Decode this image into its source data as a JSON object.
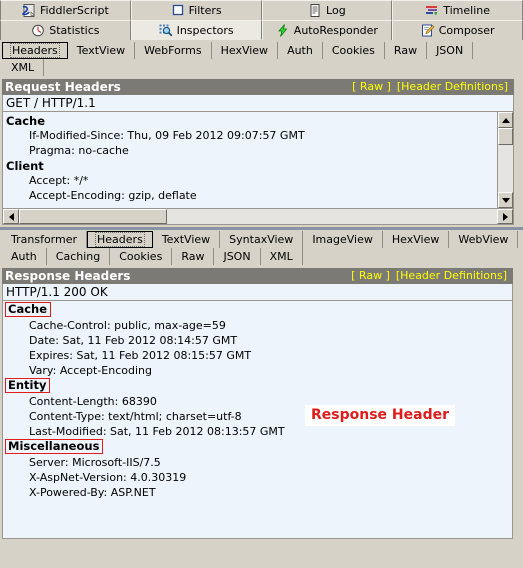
{
  "main_tabs": {
    "row1": [
      {
        "label": "FiddlerScript",
        "icon": "script-icon",
        "selected": false
      },
      {
        "label": "Filters",
        "icon": "filters-icon",
        "selected": false
      },
      {
        "label": "Log",
        "icon": "log-icon",
        "selected": false
      },
      {
        "label": "Timeline",
        "icon": "timeline-icon",
        "selected": false
      }
    ],
    "row2": [
      {
        "label": "Statistics",
        "icon": "statistics-icon",
        "selected": false
      },
      {
        "label": "Inspectors",
        "icon": "inspectors-icon",
        "selected": true
      },
      {
        "label": "AutoResponder",
        "icon": "autoresponder-icon",
        "selected": false
      },
      {
        "label": "Composer",
        "icon": "composer-icon",
        "selected": false
      }
    ]
  },
  "request_tabs": {
    "row1": [
      "Headers",
      "TextView",
      "WebForms",
      "HexView",
      "Auth",
      "Cookies",
      "Raw",
      "JSON"
    ],
    "row2": [
      "XML"
    ],
    "selected": "Headers"
  },
  "request_panel": {
    "title": "Request Headers",
    "raw_link": "[ Raw ]",
    "definitions_link": "[Header Definitions]",
    "status_line": "GET / HTTP/1.1",
    "groups": [
      {
        "name": "Cache",
        "marked": false,
        "headers": [
          "If-Modified-Since: Thu, 09 Feb 2012 09:07:57 GMT",
          "Pragma: no-cache"
        ]
      },
      {
        "name": "Client",
        "marked": false,
        "headers": [
          "Accept: */*",
          "Accept-Encoding: gzip, deflate"
        ]
      }
    ]
  },
  "response_tabs": {
    "row1": [
      "Transformer",
      "Headers",
      "TextView",
      "SyntaxView",
      "ImageView",
      "HexView",
      "WebView"
    ],
    "row2": [
      "Auth",
      "Caching",
      "Cookies",
      "Raw",
      "JSON",
      "XML"
    ],
    "selected": "Headers"
  },
  "response_panel": {
    "title": "Response Headers",
    "raw_link": "[ Raw ]",
    "definitions_link": "[Header Definitions]",
    "status_line": "HTTP/1.1 200 OK",
    "groups": [
      {
        "name": "Cache",
        "marked": true,
        "headers": [
          "Cache-Control: public, max-age=59",
          "Date: Sat, 11 Feb 2012 08:14:57 GMT",
          "Expires: Sat, 11 Feb 2012 08:15:57 GMT",
          "Vary: Accept-Encoding"
        ]
      },
      {
        "name": "Entity",
        "marked": true,
        "headers": [
          "Content-Length: 68390",
          "Content-Type: text/html; charset=utf-8",
          "Last-Modified: Sat, 11 Feb 2012 08:13:57 GMT"
        ]
      },
      {
        "name": "Miscellaneous",
        "marked": true,
        "headers": [
          "Server: Microsoft-IIS/7.5",
          "X-AspNet-Version: 4.0.30319",
          "X-Powered-By: ASP.NET"
        ]
      }
    ]
  },
  "annotation": {
    "text": "Response Header",
    "color": "#e01b1b"
  },
  "colors": {
    "window_bg": "#d6d2c8",
    "panel_bg": "#eef4fc",
    "header_bar": "#7c7a74",
    "link": "#ffff00",
    "annotation_red": "#e01b1b"
  }
}
